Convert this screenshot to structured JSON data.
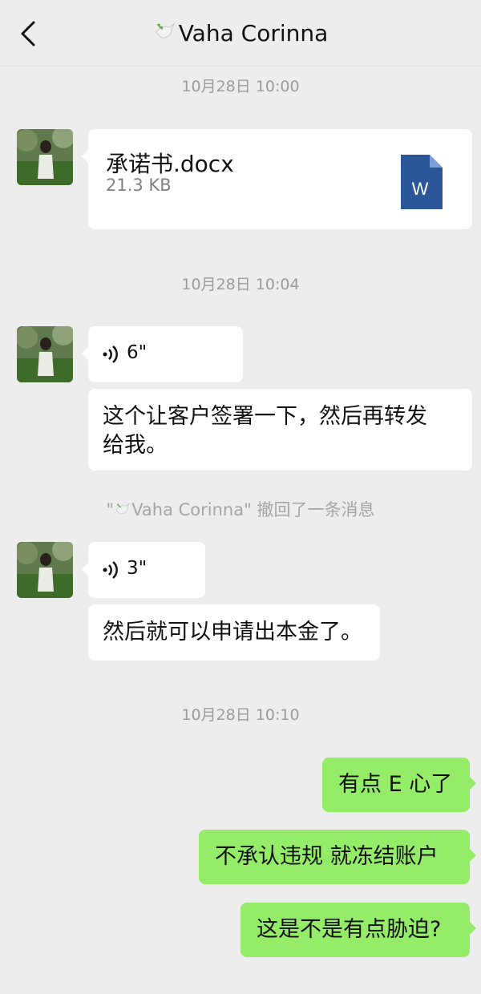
{
  "header": {
    "title": "Vaha  Corinna",
    "back_icon": "chevron-left-icon",
    "title_icon": "dove-icon"
  },
  "timestamps": [
    "10月28日 10:00",
    "10月28日 10:04",
    "10月28日 10:10"
  ],
  "messages": {
    "file": {
      "name": "承诺书.docx",
      "size": "21.3 KB",
      "icon": "word-doc-icon"
    },
    "voice1": {
      "duration": "6\"",
      "icon": "voice-wave-icon"
    },
    "text1": {
      "line1": "这个让客户签署一下，然后再转发",
      "line2": "给我。"
    },
    "voice2": {
      "duration": "3\"",
      "icon": "voice-wave-icon"
    },
    "text2": "然后就可以申请出本金了。",
    "sent": [
      "有点 E 心了",
      "不承认违规 就冻结账户",
      "这是不是有点胁迫?"
    ]
  },
  "system": {
    "quote_open": "\"",
    "name": "Vaha  Corinna",
    "quote_close": "\"",
    "text": " 撤回了一条消息"
  },
  "colors": {
    "background": "#ededed",
    "incoming_bubble": "#ffffff",
    "outgoing_bubble": "#95ec69",
    "word_blue": "#2b579a"
  }
}
